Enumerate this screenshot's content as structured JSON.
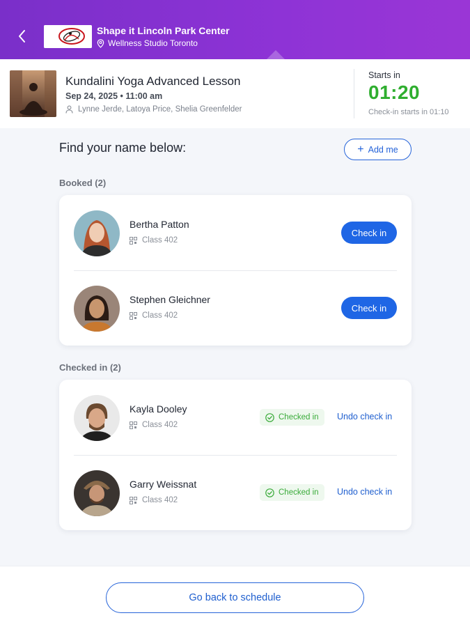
{
  "header": {
    "center_name": "Shape it Lincoln Park Center",
    "location": "Wellness Studio Toronto",
    "back_icon": "chevron-left-icon",
    "location_icon": "map-pin-icon",
    "gradient": [
      "#7a2fc9",
      "#9a36d6"
    ]
  },
  "lesson": {
    "title": "Kundalini Yoga Advanced Lesson",
    "date": "Sep 24, 2025 • 11:00 am",
    "instructors": "Lynne Jerde, Latoya Price, Shelia Greenfelder",
    "starts_label": "Starts in",
    "countdown": "01:20",
    "checkin_note": "Check-in starts in 01:10",
    "countdown_color": "#2fae2f"
  },
  "find": {
    "title": "Find your name below:",
    "add_me": "Add me"
  },
  "booked": {
    "label": "Booked (2)",
    "members": [
      {
        "name": "Bertha Patton",
        "class": "Class 402",
        "action": "Check in"
      },
      {
        "name": "Stephen Gleichner",
        "class": "Class 402",
        "action": "Check in"
      }
    ]
  },
  "checked_in": {
    "label": "Checked in (2)",
    "members": [
      {
        "name": "Kayla Dooley",
        "class": "Class 402",
        "status": "Checked in",
        "action": "Undo check in"
      },
      {
        "name": "Garry Weissnat",
        "class": "Class 402",
        "status": "Checked in",
        "action": "Undo check in"
      }
    ]
  },
  "footer": {
    "back_to_schedule": "Go back to schedule"
  },
  "colors": {
    "accent": "#1f66e5",
    "success": "#3aab3a"
  }
}
